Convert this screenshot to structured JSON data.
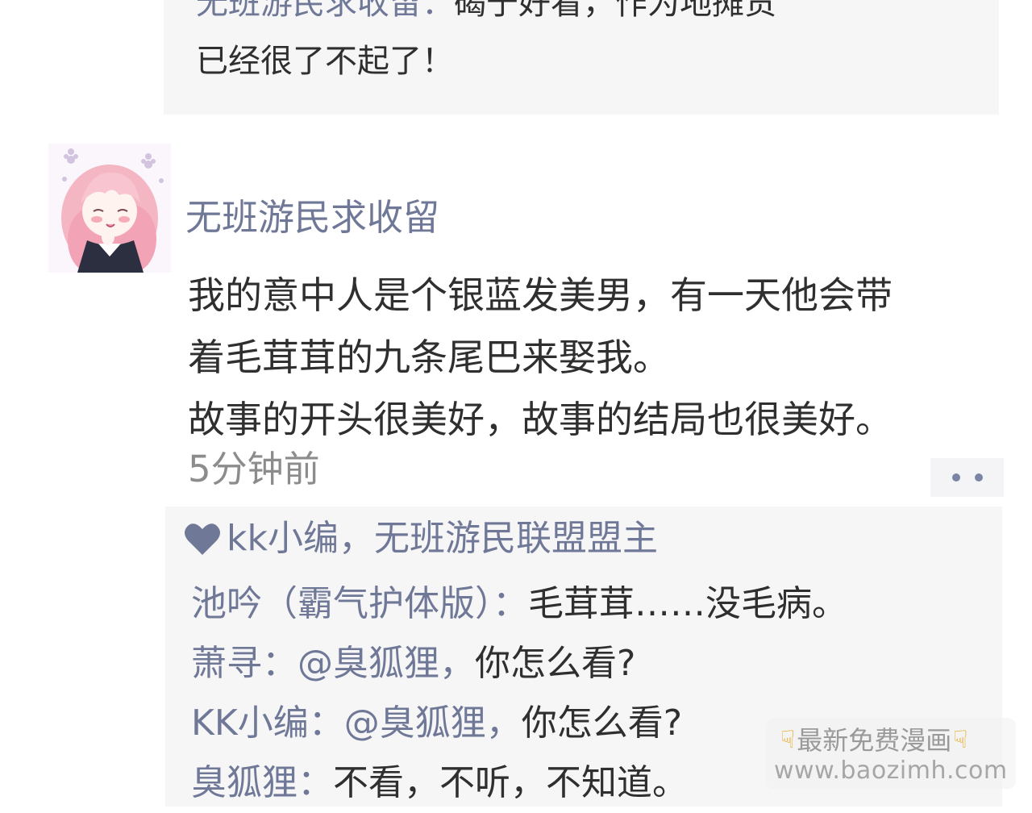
{
  "colors": {
    "username": "#707898",
    "body_text": "#2f2f2f",
    "timestamp": "#8c8c8c",
    "reply_bg": "#f6f6f6",
    "watermark_text": "#9a9a9a"
  },
  "previous_reply": {
    "author": "无班游民求收留：",
    "text_line1": "碣于好看，作为地摊货",
    "text_line2": "已经很了不起了！"
  },
  "comment": {
    "avatar_icon": "avatar-pink-hair-girl",
    "username": "无班游民求收留",
    "body": [
      "我的意中人是个银蓝发美男，有一天他会带",
      "着毛茸茸的九条尾巴来娶我。",
      "故事的开头很美好，故事的结局也很美好。"
    ],
    "timestamp": "5分钟前",
    "more_icon": "more-dots-icon"
  },
  "reply_section": {
    "likes_icon": "heart-icon",
    "likes_text": "kk小编，无班游民联盟盟主",
    "replies": [
      {
        "author": "池吟（霸气护体版）：",
        "mention": "",
        "content": "毛茸茸……没毛病。"
      },
      {
        "author": "萧寻：",
        "mention": "@臭狐狸，",
        "content": "你怎么看?"
      },
      {
        "author": "KK小编：",
        "mention": "@臭狐狸，",
        "content": "你怎么看?"
      },
      {
        "author": "臭狐狸：",
        "mention": "",
        "content": "不看，不听，不知道。"
      }
    ]
  },
  "watermark": {
    "title": "最新免费漫画",
    "url": "www.baozimh.com",
    "hand_icon": "pointing-down-hand-icon"
  }
}
